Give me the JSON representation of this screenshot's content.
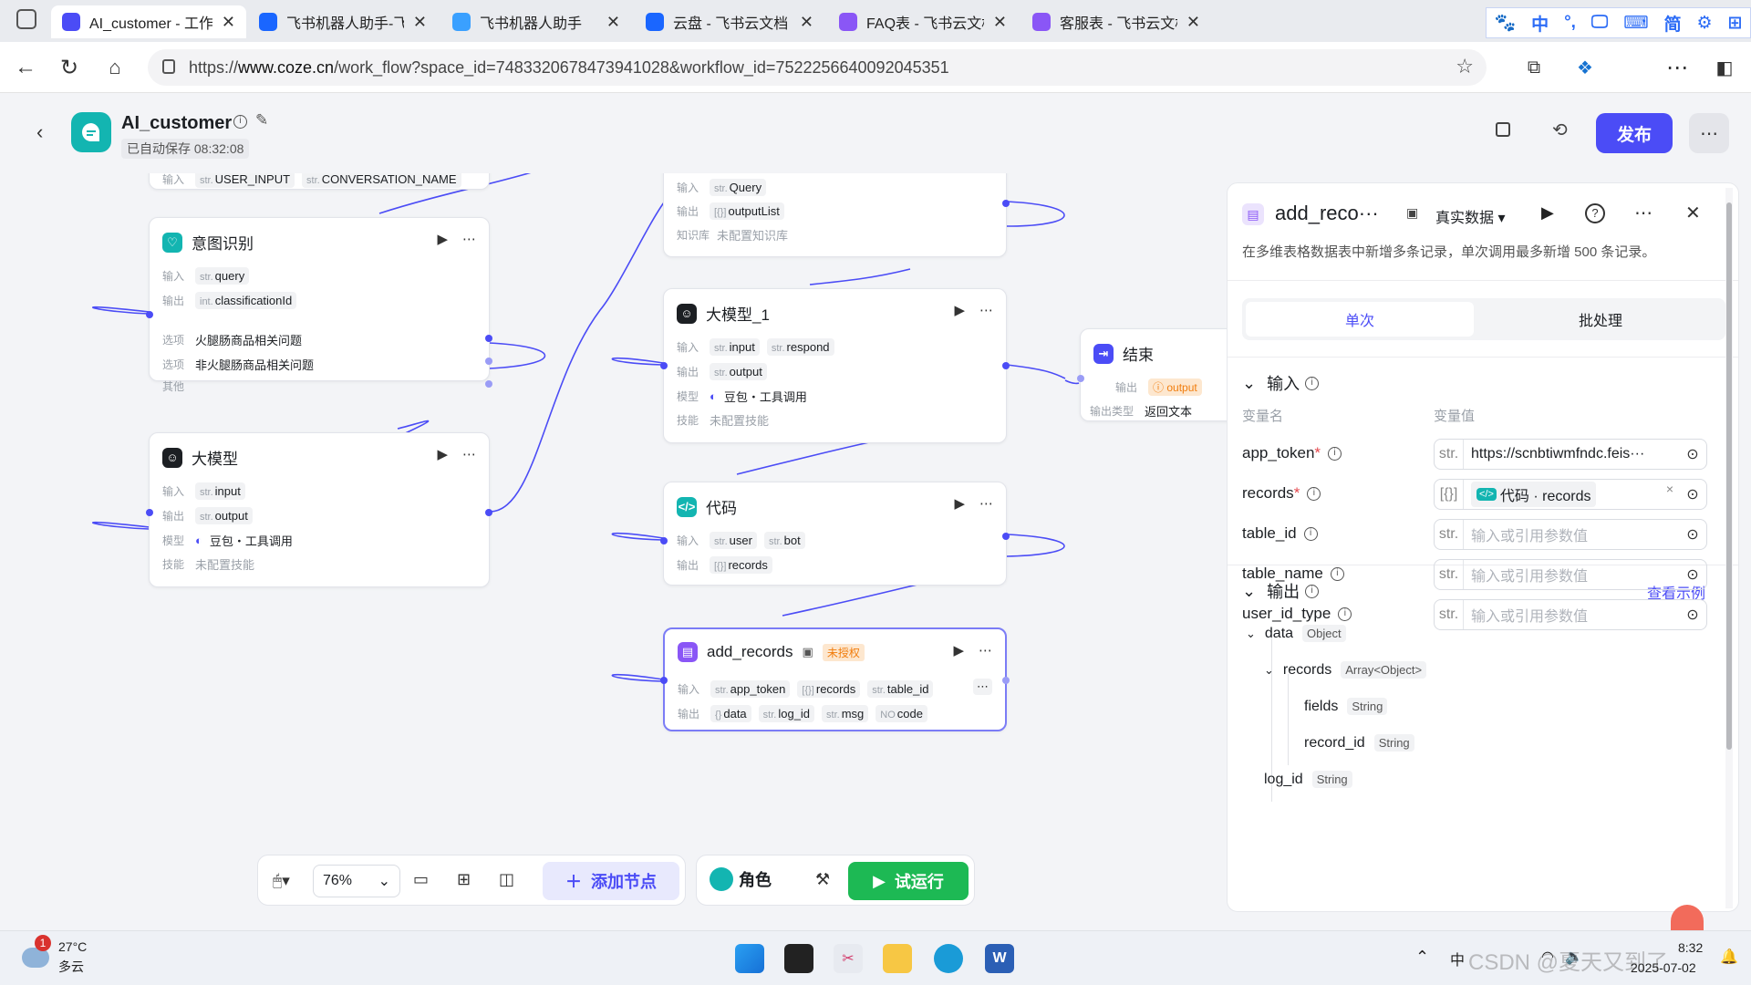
{
  "browser": {
    "tabs": [
      {
        "title": "AI_customer - 工作流 -",
        "color": "#4b4cf6",
        "active": true
      },
      {
        "title": "飞书机器人助手-飞书应",
        "color": "#1a66ff",
        "active": false
      },
      {
        "title": "飞书机器人助手",
        "color": "#3aa0ff",
        "active": false
      },
      {
        "title": "云盘 - 飞书云文档",
        "color": "#1a66ff",
        "active": false
      },
      {
        "title": "FAQ表 - 飞书云文档",
        "color": "#8a56f6",
        "active": false
      },
      {
        "title": "客服表 - 飞书云文档",
        "color": "#8a56f6",
        "active": false
      }
    ],
    "url_prefix": "https://",
    "url_host": "www.coze.cn",
    "url_rest": "/work_flow?space_id=7483320678473941028&workflow_id=7522256640092045351",
    "ime": [
      "🐾",
      "中",
      "°,",
      "🖵",
      "⌨",
      "简",
      "⚙",
      "⊞"
    ]
  },
  "app": {
    "title": "AI_customer",
    "autosave": "已自动保存 08:32:08",
    "publish_label": "发布"
  },
  "nodes": {
    "top_partial": {
      "in_label": "输入",
      "tag1": "USER_INPUT",
      "tag2": "CONVERSATION_NAME"
    },
    "intent": {
      "title": "意图识别",
      "in_label": "输入",
      "in_tag": "query",
      "out_label": "输出",
      "out_tag": "classificationId",
      "opt_label": "选项",
      "opt1": "火腿肠商品相关问题",
      "opt2": "非火腿肠商品相关问题",
      "other": "其他"
    },
    "llm": {
      "title": "大模型",
      "in_label": "输入",
      "in_tag": "input",
      "out_label": "输出",
      "out_tag": "output",
      "model_label": "模型",
      "model": "豆包・工具调用",
      "skill_label": "技能",
      "skill": "未配置技能"
    },
    "kb": {
      "in_label": "输入",
      "in_tag": "Query",
      "out_label": "输出",
      "out_tag": "outputList",
      "kb_label": "知识库",
      "kb": "未配置知识库"
    },
    "llm1": {
      "title": "大模型_1",
      "in_label": "输入",
      "in_tag1": "input",
      "in_tag2": "respond",
      "out_label": "输出",
      "out_tag": "output",
      "model_label": "模型",
      "model": "豆包・工具调用",
      "skill_label": "技能",
      "skill": "未配置技能"
    },
    "code": {
      "title": "代码",
      "in_label": "输入",
      "in_tag1": "user",
      "in_tag2": "bot",
      "out_label": "输出",
      "out_tag": "records"
    },
    "add": {
      "title": "add_records",
      "badge": "未授权",
      "in_label": "输入",
      "in_tag1": "app_token",
      "in_tag2": "records",
      "in_tag3": "table_id",
      "out_label": "输出",
      "out_tag1": "data",
      "out_tag2": "log_id",
      "out_tag3": "msg",
      "out_tag4": "code"
    },
    "end": {
      "title": "结束",
      "out_label": "输出",
      "out_tag": "output",
      "type_label": "输出类型",
      "type": "返回文本"
    }
  },
  "panel": {
    "title": "add_reco···",
    "mode": "真实数据",
    "desc": "在多维表格数据表中新增多条记录，单次调用最多新增 500 条记录。",
    "tabs": [
      "单次",
      "批处理"
    ],
    "input_title": "输入",
    "col_name": "变量名",
    "col_value": "变量值",
    "params": [
      {
        "name": "app_token",
        "required": true,
        "type": "str.",
        "value": "https://scnbtiwmfndc.feis···",
        "placeholder": false
      },
      {
        "name": "records",
        "required": true,
        "type": "[{}]",
        "value": "代码 · records",
        "placeholder": false
      },
      {
        "name": "table_id",
        "required": false,
        "type": "str.",
        "value": "输入或引用参数值",
        "placeholder": true
      },
      {
        "name": "table_name",
        "required": false,
        "type": "str.",
        "value": "输入或引用参数值",
        "placeholder": true
      },
      {
        "name": "user_id_type",
        "required": false,
        "type": "str.",
        "value": "输入或引用参数值",
        "placeholder": true
      }
    ],
    "output_title": "输出",
    "example_link": "查看示例",
    "outputs": [
      {
        "name": "data",
        "type": "Object"
      },
      {
        "name": "records",
        "type": "Array<Object>"
      },
      {
        "name": "fields",
        "type": "String"
      },
      {
        "name": "record_id",
        "type": "String"
      },
      {
        "name": "log_id",
        "type": "String"
      }
    ]
  },
  "toolbar": {
    "zoom": "76%",
    "add_node": "添加节点",
    "role": "角色",
    "run": "试运行"
  },
  "taskbar": {
    "weather_temp": "27°C",
    "weather_desc": "多云",
    "weather_badge": "1",
    "time": "8:32",
    "date": "2025-07-02",
    "tray_text": "中",
    "watermark": "CSDN @夏天又到了"
  }
}
